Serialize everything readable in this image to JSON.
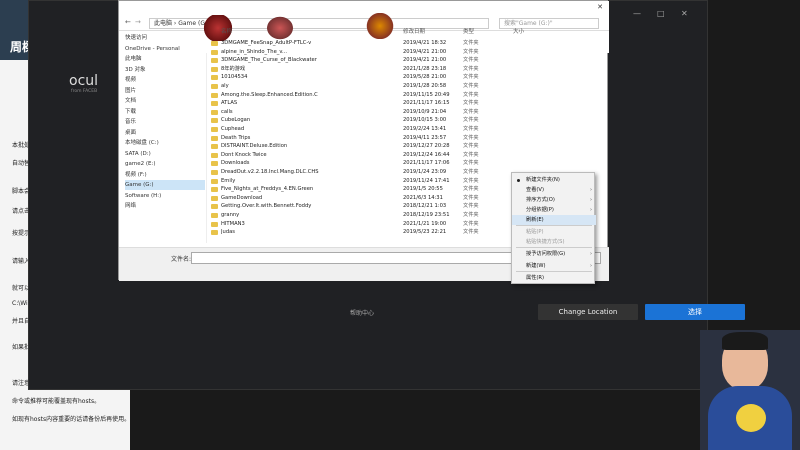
{
  "document": {
    "lines": [
      "本批处理的",
      "自动替换h",
      "脚本会自动",
      "请点击「是",
      "按提示输入",
      "请输入：1",
      "就可以自动",
      "C:\\Windo",
      "并且自动刷",
      "如果批处理",
      "请注意：",
      "命令或推荐可能覆盖现有hosts。",
      "如现有hosts内容重要的话请备份后再使用。"
    ],
    "banner": "周樑和五"
  },
  "oculus": {
    "brand": "ocul",
    "subbrand": "from FACEB",
    "help_center": "帮助中心",
    "change_location": "Change Location",
    "select": "选择"
  },
  "file_dialog": {
    "path": "此电脑 › Game (G:)",
    "search_placeholder": "搜索\"Game (G:)\"",
    "columns": {
      "name": "名称",
      "date": "修改日期",
      "type": "类型",
      "size": "大小"
    },
    "nav": [
      {
        "label": "快速访问",
        "selected": false
      },
      {
        "label": "OneDrive - Personal",
        "selected": false
      },
      {
        "label": "此电脑",
        "selected": false
      },
      {
        "label": "3D 对象",
        "selected": false
      },
      {
        "label": "视频",
        "selected": false
      },
      {
        "label": "图片",
        "selected": false
      },
      {
        "label": "文档",
        "selected": false
      },
      {
        "label": "下载",
        "selected": false
      },
      {
        "label": "音乐",
        "selected": false
      },
      {
        "label": "桌面",
        "selected": false
      },
      {
        "label": "本地磁盘 (C:)",
        "selected": false
      },
      {
        "label": "SATA (D:)",
        "selected": false
      },
      {
        "label": "game2 (E:)",
        "selected": false
      },
      {
        "label": "视频 (F:)",
        "selected": false
      },
      {
        "label": "Game (G:)",
        "selected": true
      },
      {
        "label": "Software (H:)",
        "selected": false
      },
      {
        "label": "网络",
        "selected": false
      }
    ],
    "rows": [
      {
        "name": "3DMGAME_FeeSnap_AdultP-FTLC-v",
        "date": "2019/4/21 18:32",
        "type": "文件夹"
      },
      {
        "name": "alpine_in_Shindo_The_v...",
        "date": "2019/4/21 21:00",
        "type": "文件夹"
      },
      {
        "name": "3DMGAME_The_Curse_of_Blackwater",
        "date": "2019/4/21 21:00",
        "type": "文件夹"
      },
      {
        "name": "8年的游戏",
        "date": "2021/1/28 23:18",
        "type": "文件夹"
      },
      {
        "name": "10104534",
        "date": "2019/5/28 21:00",
        "type": "文件夹"
      },
      {
        "name": "aly",
        "date": "2019/1/28 20:58",
        "type": "文件夹"
      },
      {
        "name": "Among.the.Sleep.Enhanced.Edition.C",
        "date": "2019/11/15 20:49",
        "type": "文件夹"
      },
      {
        "name": "ATLAS",
        "date": "2021/11/17 16:15",
        "type": "文件夹"
      },
      {
        "name": "calls",
        "date": "2019/10/9 21:04",
        "type": "文件夹"
      },
      {
        "name": "CubeLogan",
        "date": "2019/10/15 3:00",
        "type": "文件夹"
      },
      {
        "name": "Cuphead",
        "date": "2019/2/24 13:41",
        "type": "文件夹"
      },
      {
        "name": "Death Trips",
        "date": "2019/4/11 23:57",
        "type": "文件夹"
      },
      {
        "name": "DISTRAINT.Deluxe.Edition",
        "date": "2019/12/27 20:28",
        "type": "文件夹"
      },
      {
        "name": "Dont Knock Twice",
        "date": "2019/12/24 16:44",
        "type": "文件夹"
      },
      {
        "name": "Downloads",
        "date": "2021/11/17 17:06",
        "type": "文件夹"
      },
      {
        "name": "DreadOut.v2.2.18.Incl.Mang.DLC.CHS",
        "date": "2019/1/24 23:09",
        "type": "文件夹"
      },
      {
        "name": "Emily",
        "date": "2019/11/24 17:41",
        "type": "文件夹"
      },
      {
        "name": "Five_Nights_at_Freddys_4.EN.Green",
        "date": "2019/1/5 20:55",
        "type": "文件夹"
      },
      {
        "name": "GameDownload",
        "date": "2021/6/3 14:31",
        "type": "文件夹"
      },
      {
        "name": "Getting.Over.It.with.Bennett.Foddy",
        "date": "2018/12/21 1:03",
        "type": "文件夹"
      },
      {
        "name": "granny",
        "date": "2018/12/19 23:51",
        "type": "文件夹"
      },
      {
        "name": "HITMAN3",
        "date": "2021/1/21 19:00",
        "type": "文件夹"
      },
      {
        "name": "Judas",
        "date": "2019/5/23 22:21",
        "type": "文件夹"
      }
    ],
    "filename_label": "文件名:"
  },
  "context_menu": {
    "items": [
      {
        "label": "新建文件夹(N)",
        "disabled": false,
        "arrow": false,
        "dot": true,
        "hover": false
      },
      {
        "label": "查看(V)",
        "disabled": false,
        "arrow": true,
        "dot": false,
        "hover": false
      },
      {
        "label": "排序方式(O)",
        "disabled": false,
        "arrow": true,
        "dot": false,
        "hover": false
      },
      {
        "label": "分组依据(P)",
        "disabled": false,
        "arrow": true,
        "dot": false,
        "hover": false
      },
      {
        "label": "刷新(E)",
        "disabled": false,
        "arrow": false,
        "dot": false,
        "hover": true
      },
      {
        "label": "粘贴(P)",
        "disabled": true,
        "arrow": false,
        "dot": false,
        "hover": false
      },
      {
        "label": "粘贴快捷方式(S)",
        "disabled": true,
        "arrow": false,
        "dot": false,
        "hover": false
      },
      {
        "label": "授予访问权限(G)",
        "disabled": false,
        "arrow": true,
        "dot": false,
        "hover": false
      },
      {
        "label": "新建(W)",
        "disabled": false,
        "arrow": true,
        "dot": false,
        "hover": false
      },
      {
        "label": "属性(R)",
        "disabled": false,
        "arrow": false,
        "dot": false,
        "hover": false
      }
    ]
  },
  "colors": {
    "accent": "#1b73d6",
    "folder": "#e8c34a",
    "hover": "#d6e6f5"
  }
}
